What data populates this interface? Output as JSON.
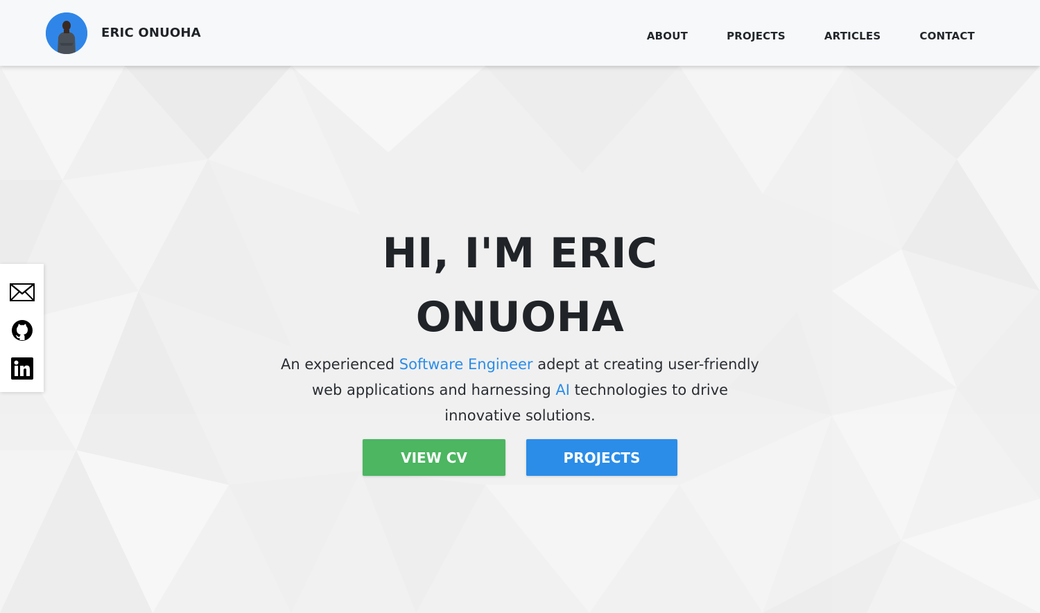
{
  "brand": {
    "name": "ERIC ONUOHA",
    "avatar_icon": "profile-photo"
  },
  "nav": {
    "items": [
      {
        "label": "ABOUT"
      },
      {
        "label": "PROJECTS"
      },
      {
        "label": "ARTICLES"
      },
      {
        "label": "CONTACT"
      }
    ]
  },
  "hero": {
    "title_line1": "HI, I'M ERIC",
    "title_line2": "ONUOHA",
    "subtitle": {
      "part1": "An experienced ",
      "highlight1": "Software Engineer",
      "part2": " adept at creating user-friendly web applications and harnessing ",
      "highlight2": "AI",
      "part3": " technologies to drive innovative solutions."
    },
    "buttons": {
      "cv_label": "VIEW CV",
      "projects_label": "PROJECTS"
    }
  },
  "social": {
    "icons": [
      "mail-icon",
      "github-icon",
      "linkedin-icon"
    ]
  },
  "colors": {
    "accent_blue": "#2b8de8",
    "cv_green": "#4cb661",
    "navbar_bg": "#f7f8fa",
    "text_dark": "#202428"
  }
}
